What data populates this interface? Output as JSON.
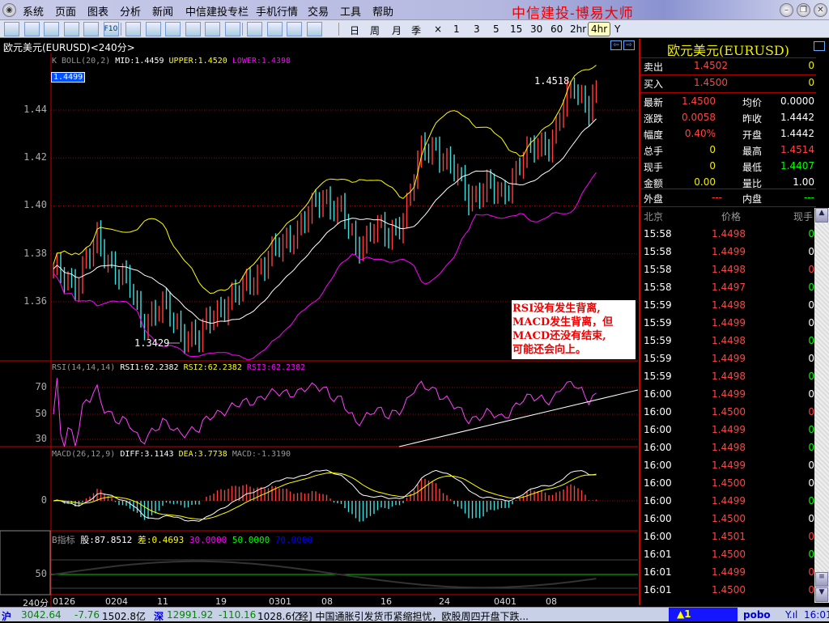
{
  "menu": {
    "items": [
      "系统",
      "页面",
      "图表",
      "分析",
      "新闻",
      "中信建投专栏",
      "手机行情",
      "交易",
      "工具",
      "帮助"
    ],
    "brand": "中信建投-博易大师"
  },
  "toolbar": {
    "icons": [
      "back-icon",
      "line-chart-icon",
      "candle-chart-icon",
      "list-icon",
      "quote-icon",
      "f10-icon",
      "refresh-icon",
      "zoom-in-icon",
      "zoom-out-icon",
      "cursor-icon",
      "window-icon",
      "export-icon",
      "draw-icon",
      "alarm-icon",
      "users-icon",
      "flash-icon"
    ],
    "f10_label": "F10",
    "periods": [
      "日",
      "周",
      "月",
      "季",
      "×",
      "1",
      "3",
      "5",
      "15",
      "30",
      "60",
      "2hr",
      "4hr",
      "Y"
    ],
    "selected_period": "4hr"
  },
  "chart": {
    "title": "欧元美元(EURUSD)<240分>",
    "cursor_price": "1.4499",
    "boll_header": {
      "name": "K  BOLL(20,2)",
      "mid": "MID:1.4459",
      "upper": "UPPER:1.4520",
      "lower": "LOWER:1.4398"
    },
    "price_ticks": [
      "1.44",
      "1.42",
      "1.40",
      "1.38",
      "1.36"
    ],
    "high_label": "1.4518",
    "low_label": "1.3429",
    "rsi_header": {
      "name": "RSI(14,14,14)",
      "rsi1": "RSI1:62.2382",
      "rsi2": "RSI2:62.2382",
      "rsi3": "RSI3:62.2382"
    },
    "rsi_ticks": [
      "70",
      "50",
      "30"
    ],
    "macd_header": {
      "name": "MACD(26,12,9)",
      "diff": "DIFF:3.1143",
      "dea": "DEA:3.7738",
      "macd": "MACD:-1.3190"
    },
    "macd_ticks": [
      "0"
    ],
    "b_header": {
      "name": "B指标",
      "gu": "股:87.8512",
      "cha": "差:0.4693",
      "v30": "30.0000",
      "v50": "50.0000",
      "v70": "70.0000"
    },
    "b_ticks": [
      "50"
    ],
    "x_period": "240分",
    "x_labels": [
      "0126",
      "0204",
      "11",
      "19",
      "0301",
      "08",
      "16",
      "24",
      "0401",
      "08"
    ],
    "annotation": [
      "RSI没有发生背离,",
      "MACD发生背离，但",
      "MACD还没有结束,",
      "可能还会向上。"
    ]
  },
  "chart_data": {
    "type": "candlestick",
    "title": "欧元美元(EURUSD) 240分",
    "ylim": [
      1.34,
      1.455
    ],
    "close_keypoints": [
      [
        0,
        1.372
      ],
      [
        6,
        1.368
      ],
      [
        12,
        1.385
      ],
      [
        15,
        1.378
      ],
      [
        21,
        1.366
      ],
      [
        24,
        1.352
      ],
      [
        30,
        1.358
      ],
      [
        35,
        1.348
      ],
      [
        40,
        1.344
      ],
      [
        44,
        1.356
      ],
      [
        50,
        1.362
      ],
      [
        59,
        1.378
      ],
      [
        68,
        1.392
      ],
      [
        74,
        1.404
      ],
      [
        79,
        1.398
      ],
      [
        83,
        1.382
      ],
      [
        88,
        1.392
      ],
      [
        92,
        1.386
      ],
      [
        96,
        1.396
      ],
      [
        101,
        1.422
      ],
      [
        105,
        1.425
      ],
      [
        110,
        1.414
      ],
      [
        114,
        1.404
      ],
      [
        119,
        1.408
      ],
      [
        123,
        1.404
      ],
      [
        128,
        1.418
      ],
      [
        132,
        1.424
      ],
      [
        137,
        1.428
      ],
      [
        140,
        1.441
      ],
      [
        143,
        1.45
      ],
      [
        147,
        1.442
      ],
      [
        149,
        1.4499
      ]
    ],
    "bars": 150
  },
  "quote": {
    "title": "欧元美元(EURUSD)",
    "ask": {
      "label": "卖出",
      "price": "1.4502",
      "vol": "0"
    },
    "bid": {
      "label": "买入",
      "price": "1.4500",
      "vol": "0"
    },
    "stats": [
      [
        "最新",
        "1.4500",
        "均价",
        "0.0000"
      ],
      [
        "涨跌",
        "0.0058",
        "昨收",
        "1.4442"
      ],
      [
        "幅度",
        "0.40%",
        "开盘",
        "1.4442"
      ],
      [
        "总手",
        "0",
        "最高",
        "1.4514"
      ],
      [
        "现手",
        "0",
        "最低",
        "1.4407"
      ],
      [
        "金额",
        "0.00",
        "量比",
        "1.00"
      ]
    ],
    "outer": {
      "label": "外盘",
      "value": "---"
    },
    "inner": {
      "label": "内盘",
      "value": "---"
    }
  },
  "trades": {
    "headers": [
      "北京",
      "价格",
      "现手"
    ],
    "rows": [
      [
        "15:58",
        "1.4498",
        "0",
        "g"
      ],
      [
        "15:58",
        "1.4499",
        "0",
        "w"
      ],
      [
        "15:58",
        "1.4498",
        "0",
        "r"
      ],
      [
        "15:58",
        "1.4497",
        "0",
        "g"
      ],
      [
        "15:59",
        "1.4498",
        "0",
        "w"
      ],
      [
        "15:59",
        "1.4499",
        "0",
        "w"
      ],
      [
        "15:59",
        "1.4498",
        "0",
        "g"
      ],
      [
        "15:59",
        "1.4499",
        "0",
        "w"
      ],
      [
        "15:59",
        "1.4498",
        "0",
        "g"
      ],
      [
        "16:00",
        "1.4499",
        "0",
        "w"
      ],
      [
        "16:00",
        "1.4500",
        "0",
        "r"
      ],
      [
        "16:00",
        "1.4499",
        "0",
        "g"
      ],
      [
        "16:00",
        "1.4498",
        "0",
        "g"
      ],
      [
        "16:00",
        "1.4499",
        "0",
        "w"
      ],
      [
        "16:00",
        "1.4500",
        "0",
        "w"
      ],
      [
        "16:00",
        "1.4499",
        "0",
        "g"
      ],
      [
        "16:00",
        "1.4500",
        "0",
        "w"
      ],
      [
        "16:00",
        "1.4501",
        "0",
        "r"
      ],
      [
        "16:01",
        "1.4500",
        "0",
        "g"
      ],
      [
        "16:01",
        "1.4499",
        "0",
        "r"
      ],
      [
        "16:01",
        "1.4500",
        "0",
        "r"
      ]
    ]
  },
  "status": {
    "sh_label": "沪",
    "sh_index": "3042.64",
    "sh_change": "-7.76",
    "sh_amount": "1502.8亿",
    "sz_label": "深",
    "sz_index": "12991.92",
    "sz_change": "-110.16",
    "sz_amount": "1028.6亿",
    "news": "经] 中国通胀引发货币紧缩担忧，欧股周四开盘下跌...",
    "alert": "▲1",
    "brand": "pobo",
    "time": "16:01"
  },
  "colors": {
    "up": "#ff4040",
    "down": "#40e0e0",
    "upper": "#ffff00",
    "lower": "#ff00ff",
    "mid": "#ffffff",
    "grid": "#a00000"
  }
}
